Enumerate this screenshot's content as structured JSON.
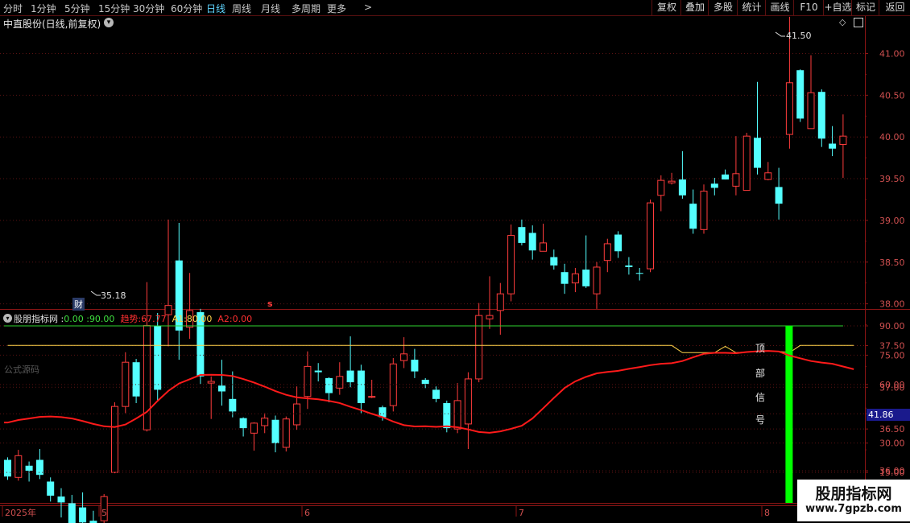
{
  "toolbar": {
    "periods": [
      {
        "label": "分时",
        "active": false
      },
      {
        "label": "1分钟",
        "active": false
      },
      {
        "label": "5分钟",
        "active": false
      },
      {
        "label": "15分钟",
        "active": false
      },
      {
        "label": "30分钟",
        "active": false
      },
      {
        "label": "60分钟",
        "active": false
      },
      {
        "label": "日线",
        "active": true
      },
      {
        "label": "周线",
        "active": false
      },
      {
        "label": "月线",
        "active": false
      },
      {
        "label": "多周期",
        "active": false
      },
      {
        "label": "更多",
        "active": false
      }
    ],
    "right_buttons": [
      "复权",
      "叠加",
      "多股",
      "统计",
      "画线",
      "F10",
      "+自选",
      "标记",
      "返回"
    ]
  },
  "main_panel": {
    "title": "中直股份(日线,前复权)",
    "high_label": "41.50",
    "low_label": "35.18",
    "marker_cai": "财",
    "marker_s": "s",
    "price_axis": [
      "41.00",
      "40.50",
      "40.00",
      "39.50",
      "39.00",
      "38.50",
      "38.00",
      "37.50",
      "37.00",
      "36.50",
      "36.00"
    ]
  },
  "indicator_panel": {
    "name": "股朋指标网",
    "sep1": ":",
    "v1": "0.00",
    "sep2": ":",
    "v2": "90.00",
    "trend_label": "趋势:",
    "trend_value": "67.77",
    "a1_label": "A1:",
    "a1_value": "80.00",
    "a2_label": "A2:",
    "a2_value": "0.00",
    "formula_link": "公式源码",
    "axis": [
      "90.00",
      "75.00",
      "60.00",
      "45.00",
      "30.00",
      "15.00"
    ],
    "current_value": "41.86",
    "signal_chars": [
      "顶",
      "部",
      "信",
      "号"
    ]
  },
  "time_axis": [
    "2025年",
    "5",
    "6",
    "7",
    "8"
  ],
  "watermark": {
    "line1": "股朋指标网",
    "line2": "www.7gpzb.com"
  },
  "colors": {
    "up": "#ff3c3c",
    "down": "#54ffff",
    "trend": "#ff1a1a",
    "a1": "#ffd24a",
    "top90": "#2fd52f",
    "signal": "#00ff00"
  },
  "chart_data": {
    "type": "candlestick",
    "candles": [
      [
        36.13,
        35.93,
        36.16,
        35.89
      ],
      [
        35.92,
        36.18,
        36.25,
        35.88
      ],
      [
        36.06,
        36.0,
        36.11,
        35.87
      ],
      [
        36.13,
        35.95,
        36.26,
        35.9
      ],
      [
        35.87,
        35.7,
        35.92,
        35.63
      ],
      [
        35.69,
        35.62,
        35.79,
        35.44
      ],
      [
        35.61,
        35.35,
        35.71,
        35.33
      ],
      [
        35.56,
        35.38,
        35.74,
        35.32
      ],
      [
        35.4,
        35.29,
        35.52,
        35.18
      ],
      [
        35.4,
        35.69,
        35.72,
        35.37
      ],
      [
        35.98,
        36.77,
        36.82,
        35.97
      ],
      [
        36.77,
        37.3,
        37.42,
        36.69
      ],
      [
        37.3,
        36.89,
        37.34,
        36.81
      ],
      [
        36.49,
        37.74,
        38.26,
        36.47
      ],
      [
        37.74,
        36.97,
        37.89,
        36.84
      ],
      [
        37.87,
        37.98,
        39.01,
        37.49
      ],
      [
        38.52,
        37.68,
        38.97,
        37.33
      ],
      [
        37.72,
        37.92,
        38.37,
        37.58
      ],
      [
        37.9,
        37.13,
        37.94,
        37.04
      ],
      [
        37.05,
        37.07,
        37.13,
        36.62
      ],
      [
        37.02,
        36.95,
        37.33,
        36.78
      ],
      [
        36.86,
        36.71,
        37.19,
        36.64
      ],
      [
        36.63,
        36.51,
        36.64,
        36.41
      ],
      [
        36.45,
        36.57,
        36.58,
        36.24
      ],
      [
        36.54,
        36.63,
        36.69,
        36.45
      ],
      [
        36.61,
        36.33,
        36.66,
        36.22
      ],
      [
        36.28,
        36.62,
        36.65,
        36.23
      ],
      [
        36.55,
        36.8,
        37.01,
        36.49
      ],
      [
        36.89,
        37.25,
        37.43,
        36.74
      ],
      [
        37.2,
        37.18,
        37.29,
        37.07
      ],
      [
        37.11,
        36.93,
        37.12,
        36.82
      ],
      [
        36.99,
        37.13,
        37.3,
        36.91
      ],
      [
        37.2,
        37.06,
        37.61,
        37.0
      ],
      [
        37.2,
        36.81,
        37.27,
        36.69
      ],
      [
        36.88,
        36.89,
        37.09,
        36.87
      ],
      [
        36.76,
        36.64,
        36.78,
        36.6
      ],
      [
        36.78,
        37.28,
        37.35,
        36.71
      ],
      [
        37.32,
        37.4,
        37.6,
        37.23
      ],
      [
        37.33,
        37.19,
        37.46,
        37.11
      ],
      [
        37.09,
        37.04,
        37.11,
        36.99
      ],
      [
        36.97,
        36.86,
        37.01,
        36.82
      ],
      [
        36.81,
        36.51,
        36.84,
        36.46
      ],
      [
        36.5,
        36.84,
        37.05,
        36.45
      ],
      [
        36.56,
        37.1,
        37.18,
        36.26
      ],
      [
        37.1,
        37.86,
        38.01,
        37.06
      ],
      [
        37.82,
        37.86,
        38.33,
        37.7
      ],
      [
        37.92,
        38.12,
        38.25,
        37.63
      ],
      [
        38.12,
        38.82,
        38.95,
        38.03
      ],
      [
        38.92,
        38.73,
        39.01,
        38.7
      ],
      [
        38.85,
        38.64,
        38.94,
        38.53
      ],
      [
        38.63,
        38.73,
        38.96,
        38.65
      ],
      [
        38.56,
        38.46,
        38.65,
        38.41
      ],
      [
        38.38,
        38.24,
        38.48,
        38.12
      ],
      [
        38.25,
        38.36,
        38.43,
        38.14
      ],
      [
        38.41,
        38.21,
        38.82,
        38.19
      ],
      [
        38.12,
        38.44,
        38.5,
        37.94
      ],
      [
        38.52,
        38.72,
        38.78,
        38.38
      ],
      [
        38.83,
        38.63,
        38.87,
        38.55
      ],
      [
        38.46,
        38.44,
        38.56,
        38.35
      ],
      [
        38.37,
        38.36,
        38.43,
        38.28
      ],
      [
        38.42,
        39.21,
        39.25,
        38.38
      ],
      [
        39.3,
        39.48,
        39.54,
        39.11
      ],
      [
        39.45,
        39.47,
        39.57,
        39.43
      ],
      [
        39.49,
        39.3,
        39.83,
        39.26
      ],
      [
        39.2,
        38.9,
        39.37,
        38.84
      ],
      [
        38.89,
        39.35,
        39.43,
        38.84
      ],
      [
        39.44,
        39.39,
        39.51,
        39.3
      ],
      [
        39.55,
        39.49,
        39.61,
        39.49
      ],
      [
        39.41,
        39.56,
        40.01,
        39.3
      ],
      [
        39.36,
        40.01,
        40.05,
        39.39
      ],
      [
        39.99,
        39.63,
        40.66,
        39.55
      ],
      [
        39.49,
        39.57,
        39.7,
        39.48
      ],
      [
        39.4,
        39.2,
        39.63,
        39.01
      ],
      [
        40.03,
        40.65,
        41.44,
        39.86
      ],
      [
        40.8,
        40.22,
        40.81,
        40.18
      ],
      [
        40.1,
        40.53,
        40.98,
        40.1
      ],
      [
        40.54,
        39.98,
        40.57,
        39.88
      ],
      [
        39.92,
        39.86,
        40.13,
        39.77
      ],
      [
        39.91,
        40.01,
        40.27,
        39.51
      ]
    ],
    "trend": [
      40.5,
      41.8,
      42.6,
      43.4,
      43.6,
      43.3,
      42.6,
      41.3,
      39.8,
      38.6,
      38.2,
      39.5,
      42.6,
      46.0,
      51.6,
      56.7,
      60.5,
      62.7,
      64.9,
      65.0,
      64.9,
      64.3,
      62.8,
      61.0,
      58.9,
      56.6,
      54.7,
      53.4,
      52.9,
      52.4,
      51.6,
      50.5,
      48.6,
      46.9,
      45.0,
      43.3,
      41.0,
      39.2,
      38.5,
      38.6,
      38.3,
      38.6,
      38.1,
      37.0,
      35.7,
      35.3,
      36.0,
      37.3,
      38.9,
      42.6,
      47.8,
      53.1,
      58.2,
      61.6,
      63.9,
      65.7,
      66.4,
      67.0,
      68.0,
      68.9,
      69.9,
      70.6,
      70.9,
      72.0,
      73.9,
      75.7,
      76.2,
      76.2,
      76.0,
      76.6,
      77.0,
      77.2,
      76.9,
      74.8,
      73.4,
      72.0,
      71.2,
      70.6,
      69.2,
      67.8
    ],
    "a1_line": 80,
    "top_line": 90,
    "signal_bar_index": 73,
    "x_labels": [
      "2025年",
      "5",
      "6",
      "7",
      "8"
    ],
    "y_axis_price": [
      36.0,
      41.0
    ],
    "y_axis_indicator": [
      15,
      90
    ]
  }
}
